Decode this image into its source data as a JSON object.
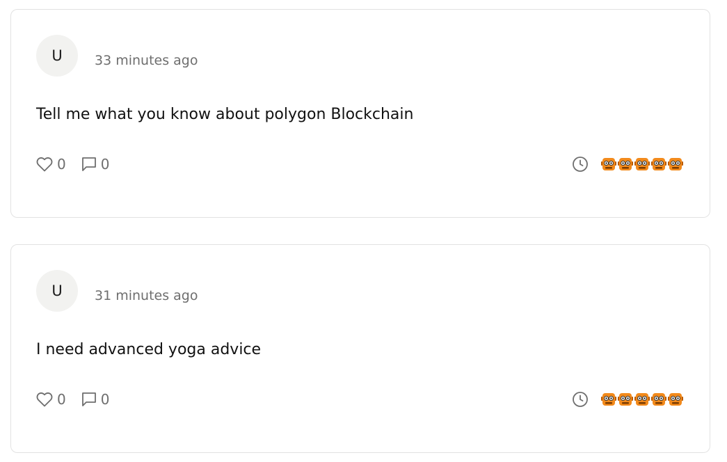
{
  "posts": [
    {
      "avatar_initial": "U",
      "timestamp": "33 minutes ago",
      "message": "Tell me what you know about polygon Blockchain",
      "likes": "0",
      "comments": "0",
      "icons": [
        "heart-icon",
        "comment-icon",
        "clock-icon",
        "robot-icon"
      ]
    },
    {
      "avatar_initial": "U",
      "timestamp": "31 minutes ago",
      "message": "I need advanced yoga advice",
      "likes": "0",
      "comments": "0",
      "icons": [
        "heart-icon",
        "comment-icon",
        "clock-icon",
        "robot-icon"
      ]
    }
  ],
  "colors": {
    "text_primary": "#111111",
    "text_muted": "#6e6e6e",
    "avatar_bg": "#f2f2f0",
    "card_border": "#e2e2e2",
    "robot_orange": "#f28a1c"
  }
}
